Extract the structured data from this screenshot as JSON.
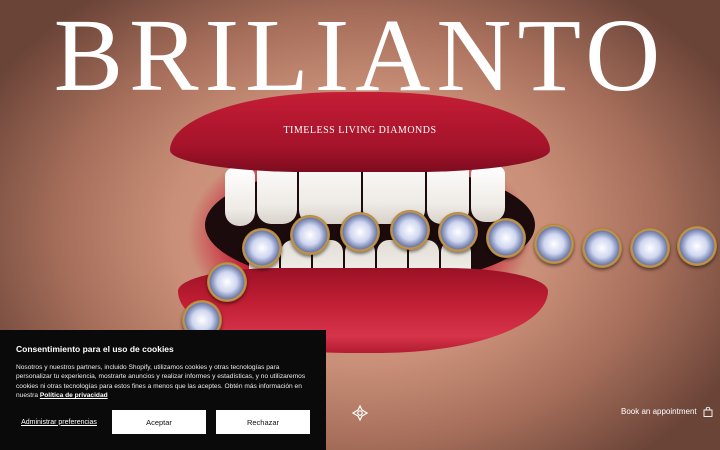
{
  "brand": {
    "name": "BRILIANTO",
    "tagline": "TIMELESS LIVING DIAMONDS"
  },
  "hero": {
    "image_desc_icon": "lips-diamond-bracelet-image"
  },
  "cookie_banner": {
    "title": "Consentimiento para el uso de cookies",
    "body": "Nosotros y nuestros partners, incluido Shopify, utilizamos cookies y otras tecnologías para personalizar tu experiencia, mostrarte anuncios y realizar informes y estadísticas, y no utilizaremos cookies ni otras tecnologías para estos fines a menos que las aceptes. Obtén más información en nuestra",
    "privacy_link": "Política de privacidad",
    "manage_label": "Administrar preferencias",
    "accept_label": "Aceptar",
    "reject_label": "Rechazar"
  },
  "footer_bar": {
    "emblem_icon": "brand-emblem-icon",
    "appointment_label": "Book an appointment",
    "bag_icon": "shopping-bag-icon"
  },
  "colors": {
    "lip_red": "#c51d36",
    "banner_bg": "#0a0a0a",
    "text_white": "#ffffff"
  }
}
